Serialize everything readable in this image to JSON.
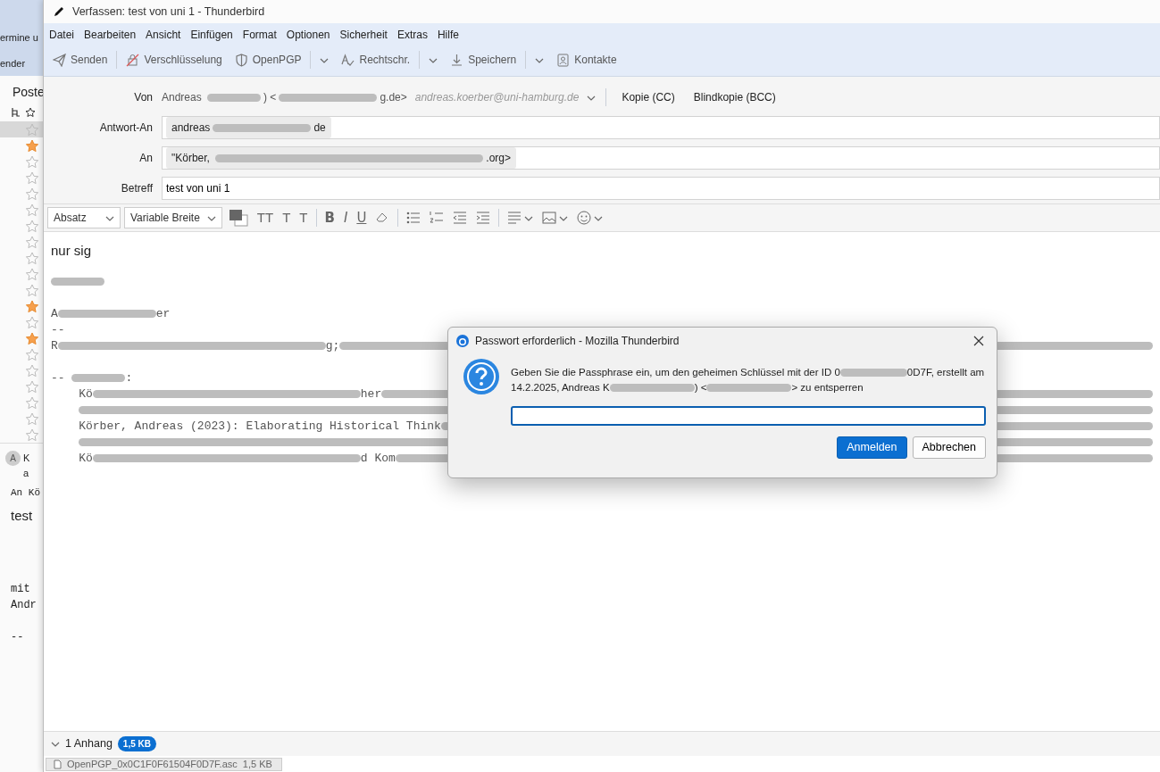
{
  "background_window": {
    "tab_fragments": [
      "ermine u",
      "ender"
    ],
    "folder_header": "Poste",
    "messages": [
      {
        "starred": false,
        "selected": true
      },
      {
        "starred": true,
        "selected": false
      },
      {
        "starred": false,
        "selected": false
      },
      {
        "starred": false,
        "selected": false
      },
      {
        "starred": false,
        "selected": false
      },
      {
        "starred": false,
        "selected": false
      },
      {
        "starred": false,
        "selected": false
      },
      {
        "starred": false,
        "selected": false
      },
      {
        "starred": false,
        "selected": false
      },
      {
        "starred": false,
        "selected": false
      },
      {
        "starred": false,
        "selected": false
      },
      {
        "starred": true,
        "selected": false
      },
      {
        "starred": false,
        "selected": false
      },
      {
        "starred": true,
        "selected": false
      },
      {
        "starred": false,
        "selected": false
      },
      {
        "starred": false,
        "selected": false
      },
      {
        "starred": false,
        "selected": false
      },
      {
        "starred": false,
        "selected": false
      },
      {
        "starred": false,
        "selected": false
      },
      {
        "starred": false,
        "selected": false
      }
    ],
    "preview": {
      "avatar": "A",
      "sender": "K",
      "address": "a",
      "to": "An Kö",
      "subject": "test",
      "body_lines": [
        "mit",
        "Andr",
        "--"
      ]
    }
  },
  "window": {
    "title": "Verfassen: test von uni 1 - Thunderbird"
  },
  "menu": [
    "Datei",
    "Bearbeiten",
    "Ansicht",
    "Einfügen",
    "Format",
    "Optionen",
    "Sicherheit",
    "Extras",
    "Hilfe"
  ],
  "toolbar": [
    {
      "label": "Senden",
      "dropdown": false
    },
    {
      "label": "Verschlüsselung",
      "dropdown": false
    },
    {
      "label": "OpenPGP",
      "dropdown": true
    },
    {
      "label": "Rechtschr.",
      "dropdown": true
    },
    {
      "label": "Speichern",
      "dropdown": true
    },
    {
      "label": "Kontakte",
      "dropdown": false
    }
  ],
  "header": {
    "from": {
      "label": "Von",
      "segments": [
        {
          "kind": "text",
          "text": "Andreas "
        },
        {
          "kind": "redacted"
        },
        {
          "kind": "text",
          "text": ") <"
        },
        {
          "kind": "redacted-long"
        },
        {
          "kind": "text",
          "text": "g.de>"
        }
      ],
      "identity": "andreas.koerber@uni-hamburg.de"
    },
    "cc": "Kopie (CC)",
    "bcc": "Blindkopie (BCC)",
    "fields": [
      {
        "label": "Antwort-An",
        "pills": [
          {
            "segments": [
              {
                "kind": "text",
                "text": "andreas"
              },
              {
                "kind": "redacted-long"
              },
              {
                "kind": "text",
                "text": "de"
              }
            ]
          }
        ]
      },
      {
        "label": "An",
        "pills": [
          {
            "segments": [
              {
                "kind": "text",
                "text": "\"Körber, "
              },
              {
                "kind": "redacted-xl"
              },
              {
                "kind": "text",
                "text": ".org>"
              }
            ]
          }
        ]
      },
      {
        "label": "Betreff",
        "value": "test von uni 1"
      }
    ]
  },
  "format_bar": {
    "paragraph": "Absatz",
    "font": "Variable Breite",
    "size_buttons": [
      "TT",
      "T",
      "T"
    ],
    "style_buttons": [
      "B",
      "I",
      "U"
    ]
  },
  "body": {
    "heading": "nur sig",
    "lines": [
      {
        "kind": "line",
        "segments": [
          {
            "kind": "redacted"
          }
        ]
      },
      {
        "kind": "blank"
      },
      {
        "kind": "line",
        "segments": [
          {
            "kind": "text",
            "text": "A"
          },
          {
            "kind": "redacted-long"
          },
          {
            "kind": "text",
            "text": "er"
          }
        ]
      },
      {
        "kind": "line",
        "segments": [
          {
            "kind": "text",
            "text": "--"
          }
        ]
      },
      {
        "kind": "line",
        "segments": [
          {
            "kind": "text",
            "text": "R"
          },
          {
            "kind": "redacted-xl"
          },
          {
            "kind": "text",
            "text": "g;"
          },
          {
            "kind": "redacted-fill"
          }
        ]
      },
      {
        "kind": "blank"
      },
      {
        "kind": "line",
        "segments": [
          {
            "kind": "text",
            "text": "-- "
          },
          {
            "kind": "redacted"
          },
          {
            "kind": "text",
            "text": ":"
          }
        ]
      },
      {
        "kind": "line",
        "segments": [
          {
            "kind": "text",
            "text": "    Kö"
          },
          {
            "kind": "redacted-xl"
          },
          {
            "kind": "text",
            "text": "her"
          },
          {
            "kind": "redacted-fill"
          }
        ]
      },
      {
        "kind": "line",
        "segments": [
          {
            "kind": "indent"
          },
          {
            "kind": "redacted-fill"
          }
        ]
      },
      {
        "kind": "line",
        "segments": [
          {
            "kind": "text",
            "text": "    Körber, Andreas (2023): Elaborating Historical Think"
          },
          {
            "kind": "redacted-fill"
          }
        ]
      },
      {
        "kind": "line",
        "segments": [
          {
            "kind": "indent"
          },
          {
            "kind": "redacted-fill"
          }
        ]
      },
      {
        "kind": "line",
        "segments": [
          {
            "kind": "text",
            "text": "    Kö"
          },
          {
            "kind": "redacted-xl"
          },
          {
            "kind": "text",
            "text": "d Kom"
          },
          {
            "kind": "redacted-fill"
          }
        ]
      }
    ]
  },
  "attachments": {
    "summary": "1 Anhang",
    "size": "1,5 KB",
    "expanded": true,
    "items": [
      {
        "name": "OpenPGP_0x0C1F0F61504F0D7F.asc",
        "size": "1,5 KB"
      }
    ]
  },
  "dialog": {
    "title": "Passwort erforderlich - Mozilla Thunderbird",
    "message_lines": [
      [
        {
          "kind": "text",
          "text": "Geben Sie die Passphrase ein, um den geheimen Schlüssel mit der ID 0"
        },
        {
          "kind": "redacted"
        },
        {
          "kind": "text",
          "text": "0D7F, erstellt am"
        }
      ],
      [
        {
          "kind": "text",
          "text": "14.2.2025, Andreas K"
        },
        {
          "kind": "redacted-long"
        },
        {
          "kind": "text",
          "text": ") <"
        },
        {
          "kind": "redacted-long"
        },
        {
          "kind": "text",
          "text": "> zu entsperren"
        }
      ]
    ],
    "buttons": [
      {
        "label": "Anmelden",
        "primary": true
      },
      {
        "label": "Abbrechen",
        "primary": false
      }
    ]
  }
}
